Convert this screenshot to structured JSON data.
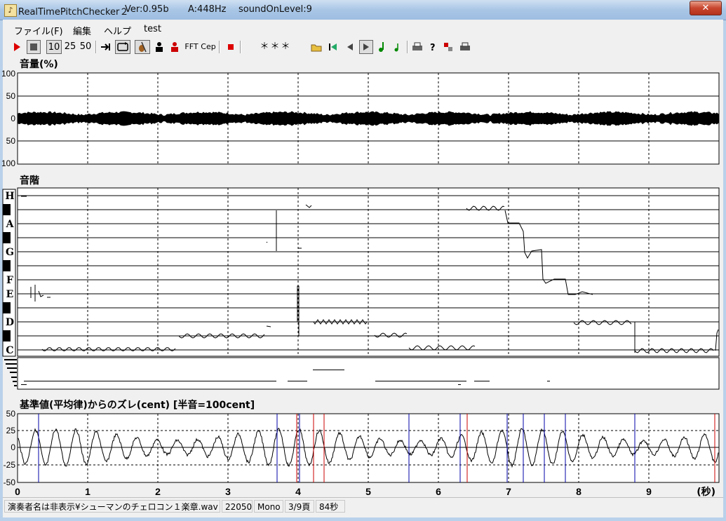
{
  "window": {
    "title_segments": [
      "RealTimePitchChecker２",
      "Ver:0.95b",
      "A:448Hz",
      "soundOnLevel:9"
    ],
    "close_glyph": "✕"
  },
  "menu": [
    "ファイル(F)",
    "編集",
    "ヘルプ",
    "test"
  ],
  "toolbar": {
    "speed_10": "10",
    "speed_25": "25",
    "speed_50": "50",
    "fft": "FFT",
    "cep": "Cep",
    "note_display": "＊＊＊"
  },
  "icons": [
    "play-icon",
    "stop-icon",
    "jump-end-icon",
    "loop-icon",
    "cello-icon",
    "person-icon",
    "person-red-icon",
    "record-icon",
    "open-folder-icon",
    "first-page-icon",
    "prev-page-icon",
    "next-page-icon",
    "note-green-icon",
    "note-small-icon",
    "print-icon",
    "help-icon",
    "marker-icon",
    "print2-icon"
  ],
  "colors": {
    "accent_red": "#cc0000",
    "guide_blue": "#0000aa",
    "guide_red": "#cc0000"
  },
  "volume": {
    "title": "音量(%)",
    "ticks": [
      "100",
      "50",
      "0",
      "50",
      "100"
    ]
  },
  "scale": {
    "title": "音階",
    "notes": [
      "H",
      "A",
      "G",
      "F",
      "E",
      "D",
      "C"
    ]
  },
  "deviation": {
    "title": "基準値(平均律)からのズレ(cent) [半音=100cent]",
    "ticks": [
      "50",
      "25",
      "0",
      "-25",
      "-50"
    ]
  },
  "time_axis": {
    "ticks": [
      "0",
      "1",
      "2",
      "3",
      "4",
      "5",
      "6",
      "7",
      "8",
      "9"
    ],
    "unit": "(秒)"
  },
  "status": {
    "file": "演奏者名は非表示¥シューマンのチェロコン１楽章.wav",
    "rate": "22050",
    "channels": "Mono",
    "page": "3/9頁",
    "duration": "84秒"
  }
}
